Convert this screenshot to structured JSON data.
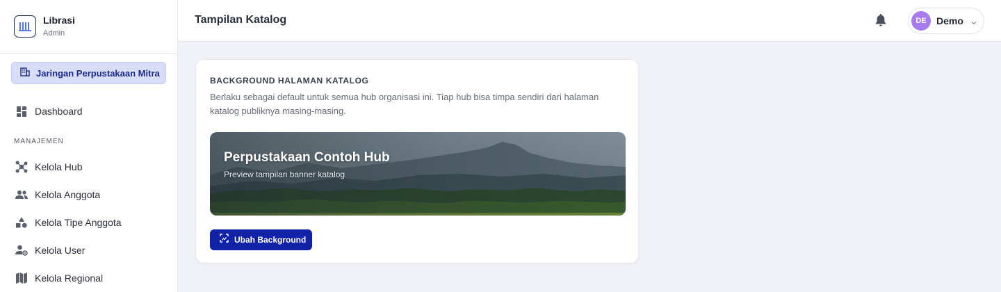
{
  "brand": {
    "name": "Librasi",
    "role": "Admin",
    "logo_icon": "library-bars-icon"
  },
  "org_switcher": {
    "label": "Jaringan Perpustakaan Mitra",
    "icon": "building-icon"
  },
  "sidebar": {
    "dashboard": {
      "label": "Dashboard",
      "icon": "dashboard-icon"
    },
    "section_label": "MANAJEMEN",
    "items": [
      {
        "label": "Kelola Hub",
        "icon": "hub-network-icon"
      },
      {
        "label": "Kelola Anggota",
        "icon": "people-icon"
      },
      {
        "label": "Kelola Tipe Anggota",
        "icon": "shapes-icon"
      },
      {
        "label": "Kelola User",
        "icon": "user-gear-icon"
      },
      {
        "label": "Kelola Regional",
        "icon": "map-icon"
      }
    ]
  },
  "header": {
    "title": "Tampilan Katalog",
    "notification_icon": "bell-icon",
    "user": {
      "initials": "DE",
      "name": "Demo",
      "dropdown_icon": "chevron-down-icon"
    }
  },
  "card": {
    "title": "BACKGROUND HALAMAN KATALOG",
    "description": "Berlaku sebagai default untuk semua hub organisasi ini. Tiap hub bisa timpa sendiri dari halaman katalog publiknya masing-masing.",
    "banner": {
      "title": "Perpustakaan Contoh Hub",
      "subtitle": "Preview tampilan banner katalog"
    },
    "button": {
      "label": "Ubah Background",
      "icon": "image-edit-icon"
    }
  },
  "colors": {
    "accent": "#1122a8",
    "chip_bg": "#d8defa",
    "avatar_bg": "#a77bef",
    "page_bg": "#f1f2f7"
  }
}
